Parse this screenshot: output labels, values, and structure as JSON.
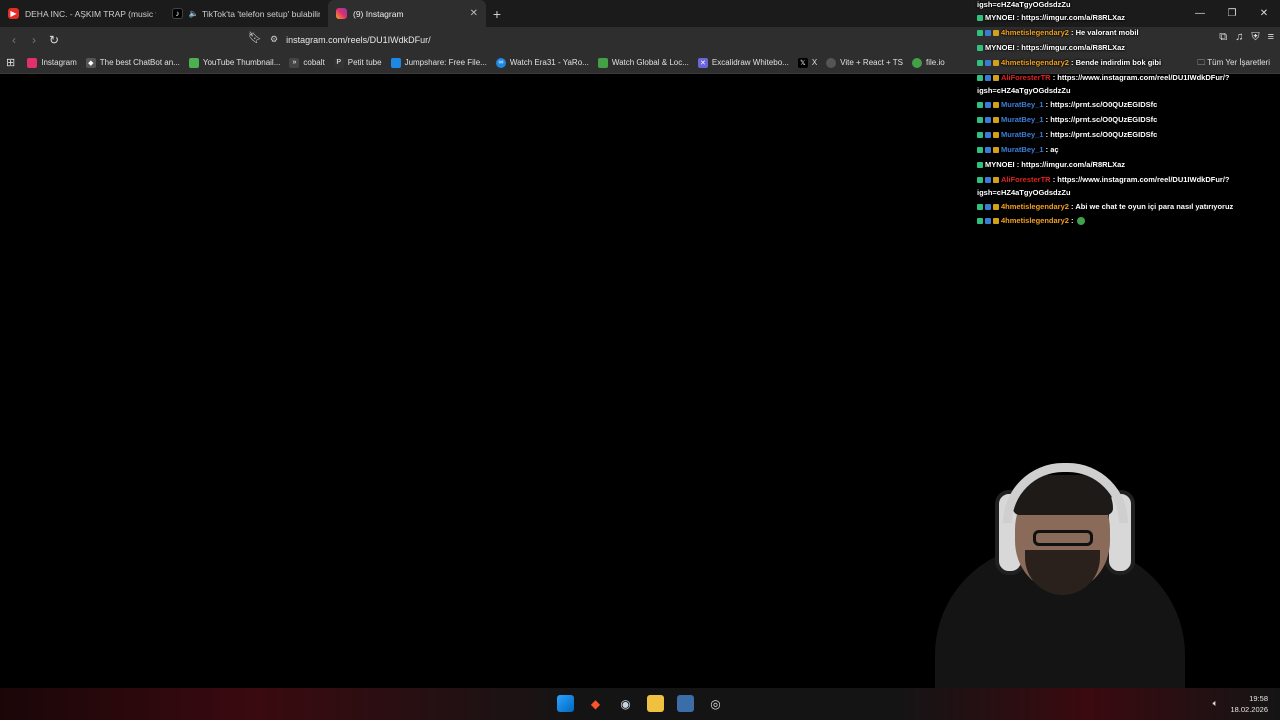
{
  "tabs": [
    {
      "title": "DEHA INC. - AŞKIM TRAP (music vide",
      "icon": "youtube-icon"
    },
    {
      "title": "TikTok'ta 'telefon setup' bulabilin",
      "icon": "tiktok-icon"
    },
    {
      "title": "(9) Instagram",
      "icon": "instagram-icon",
      "active": true
    }
  ],
  "toolbar": {
    "url": "instagram.com/reels/DU1IWdkDFur/"
  },
  "bookmarks": [
    {
      "label": "Instagram",
      "color": "#e1306c"
    },
    {
      "label": "The best ChatBot an...",
      "color": "#ffffff"
    },
    {
      "label": "YouTube Thumbnail...",
      "color": "#4caf50"
    },
    {
      "label": "cobalt",
      "color": "#444444"
    },
    {
      "label": "Petit tube",
      "color": "#333333"
    },
    {
      "label": "Jumpshare: Free File...",
      "color": "#1e88e5"
    },
    {
      "label": "Watch Era31 - YaRo...",
      "color": "#1e88e5"
    },
    {
      "label": "Watch Global & Loc...",
      "color": "#43a047"
    },
    {
      "label": "Excalidraw Whitebo...",
      "color": "#6965db"
    },
    {
      "label": "X",
      "color": "#000000"
    },
    {
      "label": "Vite + React + TS",
      "color": "#555555"
    },
    {
      "label": "file.io",
      "color": "#43a047"
    }
  ],
  "all_bookmarks": "Tüm Yer İşaretleri",
  "chat": [
    {
      "user": "",
      "user_color": "",
      "text": "igsh=cHZ4aTgyOGdsdzZu",
      "badges": []
    },
    {
      "user": "MYNOEI",
      "user_color": "white",
      "text": ": https://imgur.com/a/R8RLXaz",
      "badges": [
        "green"
      ]
    },
    {
      "user": "4hmetislegendary2",
      "user_color": "orange",
      "text": ": He valorant mobil",
      "badges": [
        "green",
        "blue",
        "gold"
      ]
    },
    {
      "user": "MYNOEI",
      "user_color": "white",
      "text": ": https://imgur.com/a/R8RLXaz",
      "badges": [
        "green"
      ]
    },
    {
      "user": "4hmetislegendary2",
      "user_color": "orange",
      "text": ": Bende indirdim bok gibi",
      "badges": [
        "green",
        "blue",
        "gold"
      ]
    },
    {
      "user": "AliForesterTR",
      "user_color": "red",
      "text": ": https://www.instagram.com/reel/DU1IWdkDFur/?",
      "badges": [
        "green",
        "blue",
        "gold"
      ]
    },
    {
      "user": "",
      "user_color": "",
      "text": "igsh=cHZ4aTgyOGdsdzZu",
      "badges": []
    },
    {
      "user": "MuratBey_1",
      "user_color": "blue",
      "text": ": https://prnt.sc/O0QUzEGIDSfc",
      "badges": [
        "green",
        "blue",
        "gold"
      ]
    },
    {
      "user": "MuratBey_1",
      "user_color": "blue",
      "text": ": https://prnt.sc/O0QUzEGIDSfc",
      "badges": [
        "green",
        "blue",
        "gold"
      ]
    },
    {
      "user": "MuratBey_1",
      "user_color": "blue",
      "text": ": https://prnt.sc/O0QUzEGIDSfc",
      "badges": [
        "green",
        "blue",
        "gold"
      ]
    },
    {
      "user": "MuratBey_1",
      "user_color": "blue",
      "text": ": aç",
      "badges": [
        "green",
        "blue",
        "gold"
      ]
    },
    {
      "user": "MYNOEI",
      "user_color": "white",
      "text": ": https://imgur.com/a/R8RLXaz",
      "badges": [
        "green"
      ]
    },
    {
      "user": "AliForesterTR",
      "user_color": "red",
      "text": ": https://www.instagram.com/reel/DU1IWdkDFur/?",
      "badges": [
        "green",
        "blue",
        "gold"
      ]
    },
    {
      "user": "",
      "user_color": "",
      "text": "igsh=cHZ4aTgyOGdsdzZu",
      "badges": []
    },
    {
      "user": "4hmetislegendary2",
      "user_color": "orange",
      "text": ": Abi we chat te oyun içi para nasıl yatırıyoruz",
      "badges": [
        "green",
        "blue",
        "gold"
      ]
    },
    {
      "user": "4hmetislegendary2",
      "user_color": "orange",
      "text": ":",
      "badges": [
        "green",
        "blue",
        "gold"
      ],
      "emote": true
    }
  ],
  "taskbar": {
    "time": "19:58",
    "date": "18.02.2026"
  }
}
